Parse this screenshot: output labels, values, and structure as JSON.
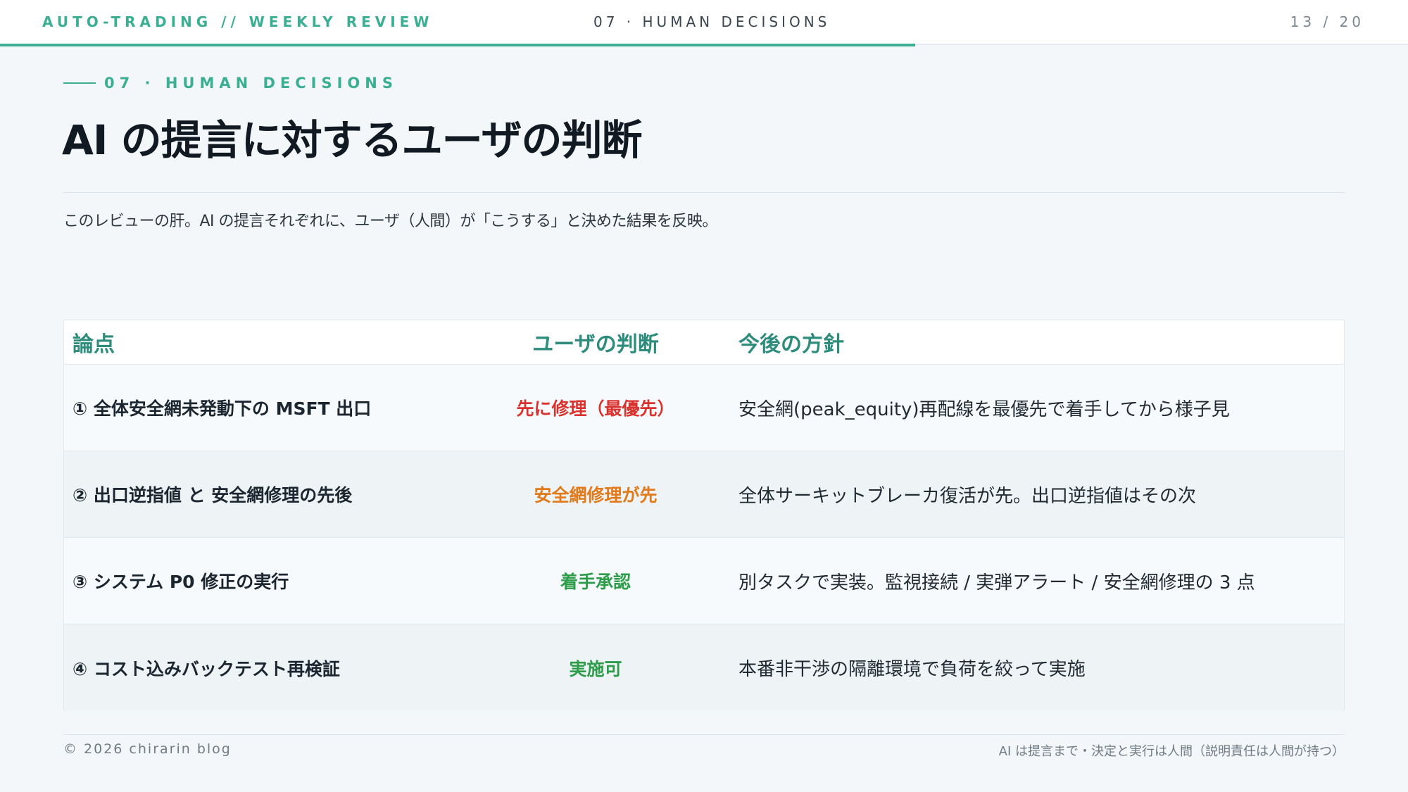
{
  "header": {
    "brand": "AUTO-TRADING // WEEKLY REVIEW",
    "section": "07 · HUMAN DECISIONS",
    "page_counter": "13 / 20",
    "progress": 0.65,
    "accent_color": "#3aaf94"
  },
  "slide": {
    "section_label": "07 · HUMAN DECISIONS",
    "title": "AI の提言に対するユーザの判断",
    "lead": "このレビューの肝。AI の提言それぞれに、ユーザ（人間）が「こうする」と決めた結果を反映。"
  },
  "table": {
    "headers": [
      "論点",
      "ユーザの判断",
      "今後の方針"
    ],
    "rows": [
      {
        "issue": "① 全体安全網未発動下の MSFT 出口",
        "decision": "先に修理（最優先）",
        "decision_color": "#d8332f",
        "policy": "安全網(peak_equity)再配線を最優先で着手してから様子見"
      },
      {
        "issue": "② 出口逆指値 と 安全網修理の先後",
        "decision": "安全網修理が先",
        "decision_color": "#e07a1a",
        "policy": "全体サーキットブレーカ復活が先。出口逆指値はその次"
      },
      {
        "issue": "③ システム P0 修正の実行",
        "decision": "着手承認",
        "decision_color": "#2e9d4a",
        "policy": "別タスクで実装。監視接続 / 実弾アラート / 安全網修理の 3 点"
      },
      {
        "issue": "④ コスト込みバックテスト再検証",
        "decision": "実施可",
        "decision_color": "#2e9d4a",
        "policy": "本番非干渉の隔離環境で負荷を絞って実施"
      }
    ]
  },
  "footer": {
    "copyright": "© 2026 chirarin blog",
    "note": "AI は提言まで・決定と実行は人間（説明責任は人間が持つ）"
  }
}
